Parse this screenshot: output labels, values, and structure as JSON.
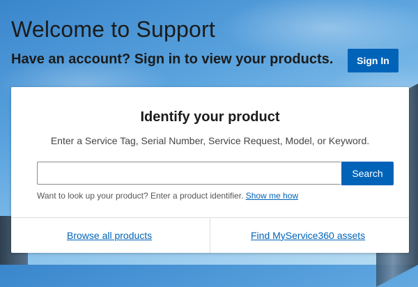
{
  "header": {
    "welcome": "Welcome to Support",
    "account_prompt": "Have an account? Sign in to view your products.",
    "signin_label": "Sign In"
  },
  "card": {
    "title": "Identify your product",
    "subtitle": "Enter a Service Tag, Serial Number, Service Request, Model, or Keyword.",
    "search": {
      "value": "",
      "placeholder": "",
      "button_label": "Search"
    },
    "hint_text": "Want to look up your product? Enter a product identifier.",
    "hint_link": "Show me how",
    "browse_link": "Browse all products",
    "assets_link": "Find MyService360 assets"
  },
  "colors": {
    "accent": "#0063b8",
    "text": "#1b1b1b"
  }
}
